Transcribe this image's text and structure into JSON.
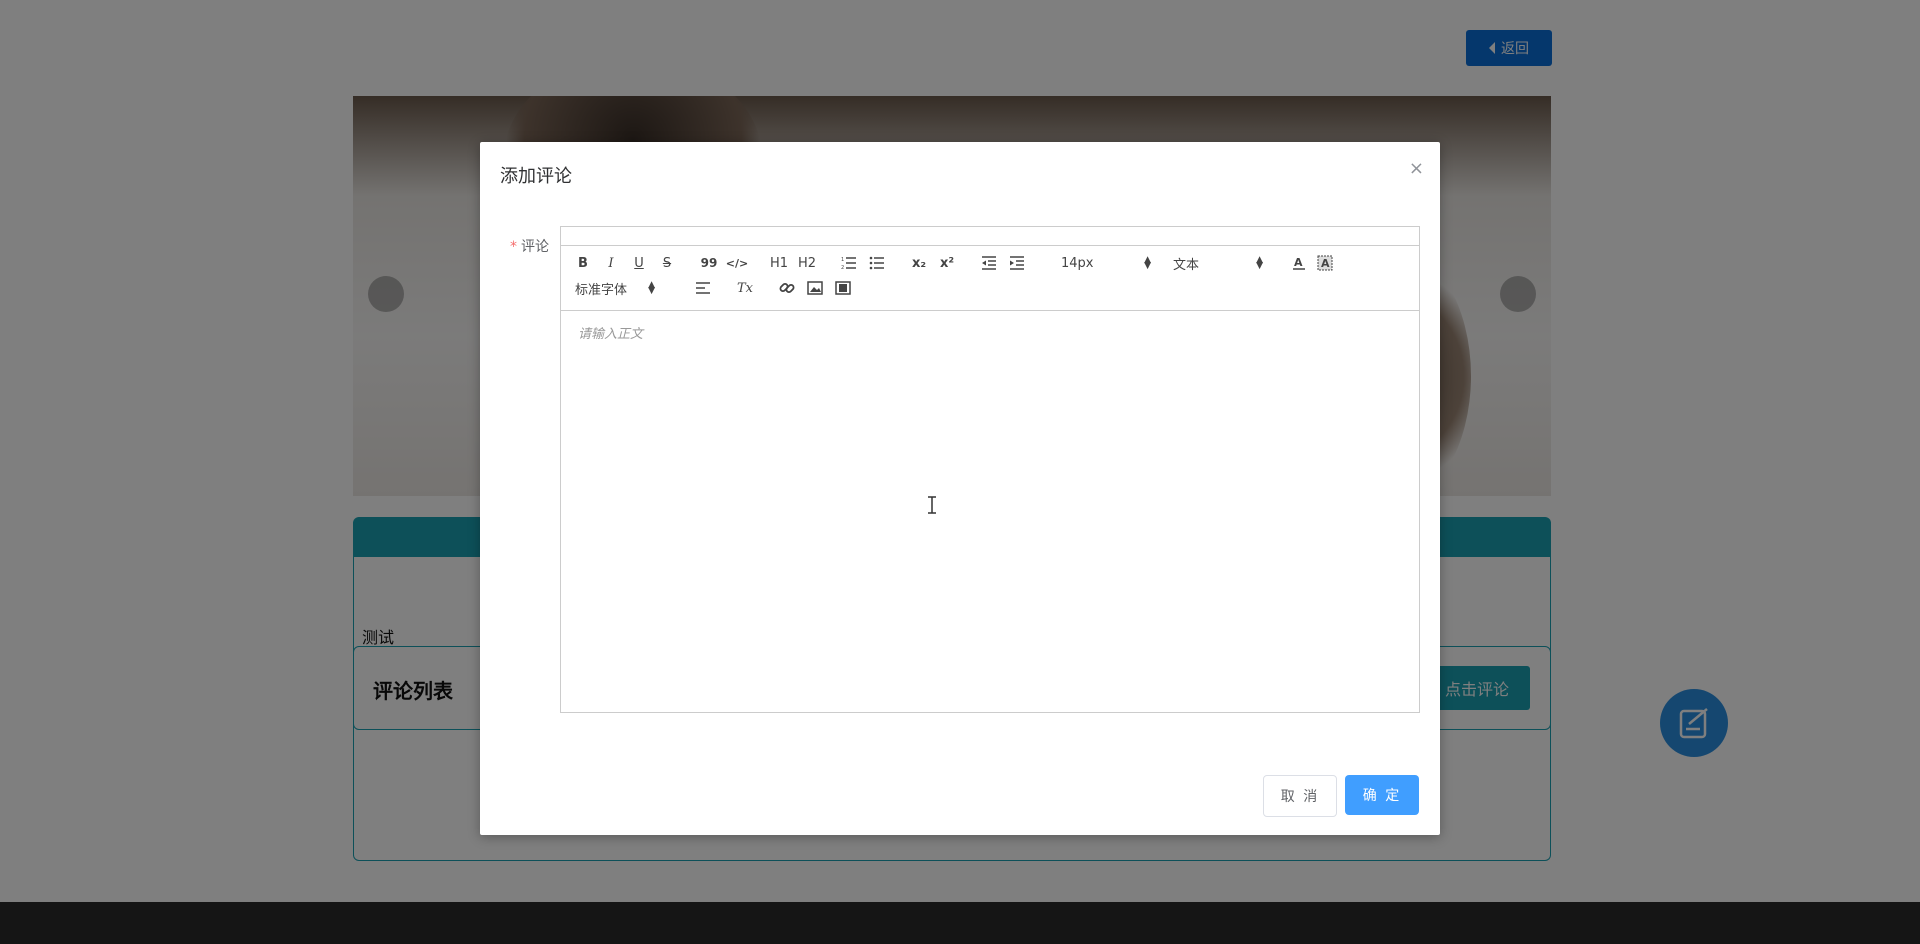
{
  "page": {
    "back_label": "返回",
    "test_label": "测试",
    "comment_list_title": "评论列表",
    "click_comment_label": "点击评论"
  },
  "dialog": {
    "title": "添加评论",
    "close_label": "×",
    "form_label": "评论",
    "required_mark": "*",
    "placeholder": "请输入正文",
    "cancel_label": "取 消",
    "confirm_label": "确 定"
  },
  "toolbar": {
    "bold": "B",
    "italic": "I",
    "underline": "U",
    "strike": "S",
    "quote": "99",
    "code": "</>",
    "h1": "H1",
    "h2": "H2",
    "sub": "x₂",
    "sup": "x²",
    "font_size": "14px",
    "header_select": "文本",
    "font_family": "标准字体",
    "clean": "Tx"
  },
  "colors": {
    "primary": "#409eff",
    "back_button": "#0a6fd8",
    "teal": "#1aa0b2",
    "required": "#f56c6c",
    "fab": "#2a8fe0"
  }
}
